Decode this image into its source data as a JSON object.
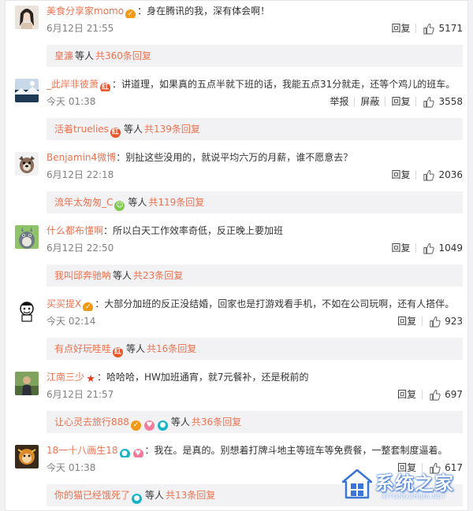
{
  "comments": [
    {
      "username": "美食分享家momo",
      "badges": [
        "orange"
      ],
      "text": "：身在腾讯的我，深有体会啊！",
      "time": "6月12日 21:55",
      "actions": [
        "回复"
      ],
      "likes": "5171",
      "sub": {
        "users": "皇濂",
        "badges": [],
        "etc": "等人",
        "count": "共360条回复"
      },
      "avatar": "woman-portrait"
    },
    {
      "username": "_此岸非彼萧",
      "badges": [
        "red"
      ],
      "text": "：讲道理，如果真的五点半就下班的话，我能五点31分就走，还等个鸡儿的班车。",
      "time": "今天 01:38",
      "actions": [
        "举报",
        "屏蔽",
        "回复"
      ],
      "likes": "3558",
      "sub": {
        "users": "活着truelies",
        "badges": [
          "red"
        ],
        "etc": "等人",
        "count": "共139条回复"
      },
      "avatar": "winter-landscape"
    },
    {
      "username": "Benjamin4微博",
      "badges": [],
      "text": "：别扯这些没用的，就说平均六万的月薪，谁不愿意去？",
      "time": "6月12日 22:18",
      "actions": [
        "回复"
      ],
      "likes": "2036",
      "sub": {
        "users": "流年太匆匆_C",
        "badges": [
          "green"
        ],
        "etc": "等人",
        "count": "共119条回复"
      },
      "avatar": "dog"
    },
    {
      "username": "什么都布懂啊",
      "badges": [],
      "text": "：所以白天工作效率奇低，反正晚上要加班",
      "time": "6月12日 22:50",
      "actions": [
        "回复"
      ],
      "likes": "1049",
      "sub": {
        "users": "我叫邱奔驰呐",
        "badges": [],
        "etc": "等人",
        "count": "共23条回复"
      },
      "avatar": "totoro"
    },
    {
      "username": "买买提X",
      "badges": [
        "orange"
      ],
      "text": "：大部分加班的反正没结婚，回家也是打游戏看手机，不如在公司玩啊，还有人搭伴。",
      "time": "今天 02:14",
      "actions": [
        "回复"
      ],
      "likes": "923",
      "sub": {
        "users": "有点好玩哇哇",
        "badges": [
          "red"
        ],
        "etc": "等人",
        "count": "共16条回复"
      },
      "avatar": "cartoon"
    },
    {
      "username": "江南三少",
      "badges": [
        "star"
      ],
      "text": "：哈哈哈，HW加班通宵，就7元餐补，还是税前的",
      "time": "6月12日 21:57",
      "actions": [
        "回复"
      ],
      "likes": "697",
      "sub": {
        "users": "让心灵去旅行888",
        "badges": [
          "orange",
          "pink",
          "teal"
        ],
        "etc": "等人",
        "count": "共36条回复"
      },
      "avatar": "man-outdoor"
    },
    {
      "username": "18一十八画生18",
      "badges": [
        "teal",
        "pink"
      ],
      "text": "：我在。是真的。别想着打牌斗地主等班车等免费餐，一整套制度逼着。",
      "time": "今天 01:38",
      "actions": [
        "回复"
      ],
      "likes": "617",
      "sub": {
        "users": "你的猫已经饿死了",
        "badges": [
          "teal"
        ],
        "etc": "等人",
        "count": "共13条回复"
      },
      "avatar": "monkey"
    }
  ],
  "watermark": {
    "text": "系统之家",
    "url": "XITONGZHIJIA.NET"
  },
  "colors": {
    "accent": "#eb7350",
    "link": "#eb7350",
    "muted": "#808080",
    "subbox": "#f2f2f5"
  }
}
